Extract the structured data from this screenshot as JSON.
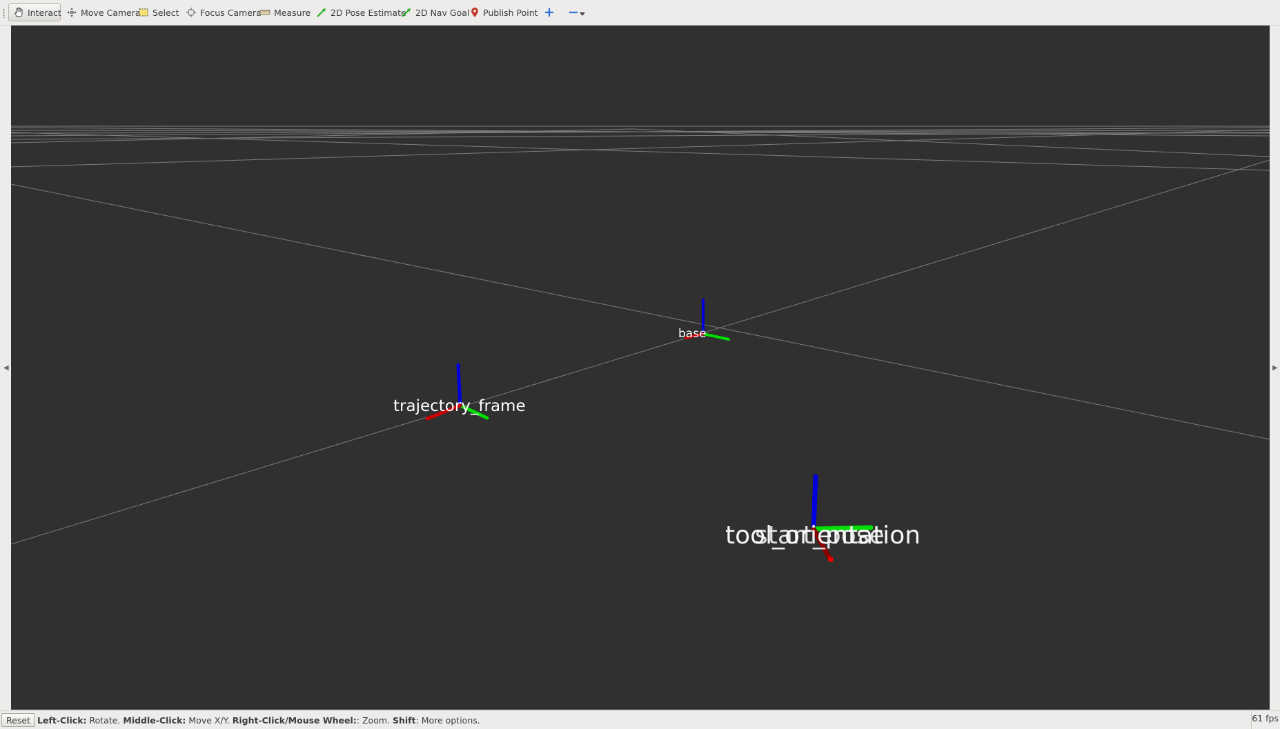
{
  "toolbar": {
    "tools": [
      {
        "label": "Interact",
        "icon": "hand-icon",
        "active": true
      },
      {
        "label": "Move Camera",
        "icon": "move-camera-icon"
      },
      {
        "label": "Select",
        "icon": "select-icon"
      },
      {
        "label": "Focus Camera",
        "icon": "focus-camera-icon"
      },
      {
        "label": "Measure",
        "icon": "ruler-icon"
      },
      {
        "label": "2D Pose Estimate",
        "icon": "green-arrow-icon"
      },
      {
        "label": "2D Nav Goal",
        "icon": "green-arrow-icon"
      },
      {
        "label": "Publish Point",
        "icon": "map-pin-icon"
      }
    ],
    "add_tool_icon": "plus-icon",
    "remove_tool_icon": "minus-icon"
  },
  "viewport": {
    "background": "#303030",
    "grid_color": "#8a8a8a",
    "axis_colors": {
      "x": "#cc0000",
      "y": "#00dd00",
      "z": "#0000dd"
    },
    "frames": [
      {
        "name": "base"
      },
      {
        "name": "trajectory_frame"
      },
      {
        "name": "tool_orientation"
      },
      {
        "name": "start_pose"
      }
    ]
  },
  "statusbar": {
    "reset_label": "Reset",
    "hint_parts": [
      {
        "bold": "Left-Click:",
        "text": " Rotate. "
      },
      {
        "bold": "Middle-Click:",
        "text": " Move X/Y. "
      },
      {
        "bold": "Right-Click/Mouse Wheel:",
        "text": ": Zoom. "
      },
      {
        "bold": "Shift",
        "text": ": More options."
      }
    ],
    "fps": "61 fps"
  }
}
